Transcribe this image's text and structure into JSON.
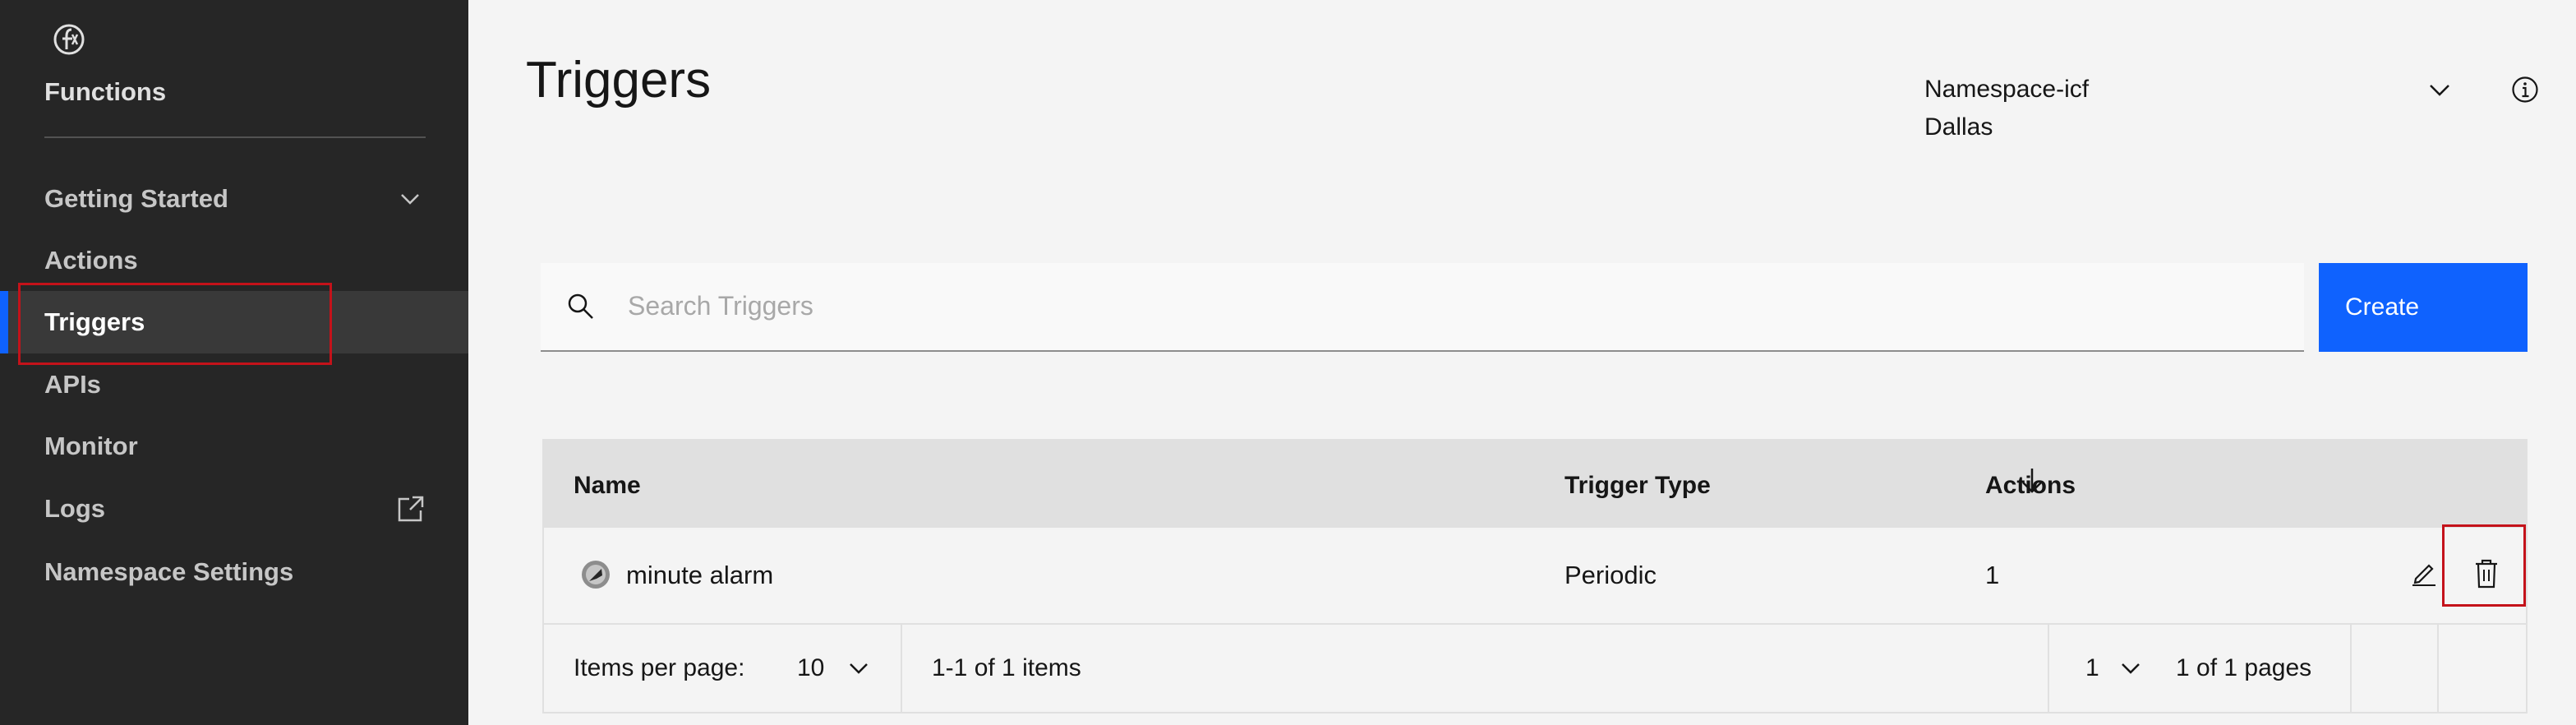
{
  "sidebar": {
    "app_title": "Functions",
    "items": [
      {
        "label": "Getting Started"
      },
      {
        "label": "Actions"
      },
      {
        "label": "Triggers"
      },
      {
        "label": "APIs"
      },
      {
        "label": "Monitor"
      },
      {
        "label": "Logs"
      },
      {
        "label": "Namespace Settings"
      }
    ]
  },
  "header": {
    "title": "Triggers",
    "namespace": "Namespace-icf",
    "region": "Dallas"
  },
  "search": {
    "placeholder": "Search Triggers",
    "value": ""
  },
  "toolbar": {
    "create_label": "Create"
  },
  "table": {
    "columns": [
      "Name",
      "Trigger Type",
      "Actions"
    ],
    "rows": [
      {
        "name": "minute alarm",
        "type": "Periodic",
        "actions": "1"
      }
    ]
  },
  "pagination": {
    "items_per_page_label": "Items per page:",
    "items_per_page": "10",
    "range": "1-1 of 1 items",
    "page": "1",
    "pages": "1 of 1 pages"
  },
  "colors": {
    "accent": "#0f62fe",
    "sidebar_bg": "#262626",
    "highlight": "#c4121a"
  }
}
